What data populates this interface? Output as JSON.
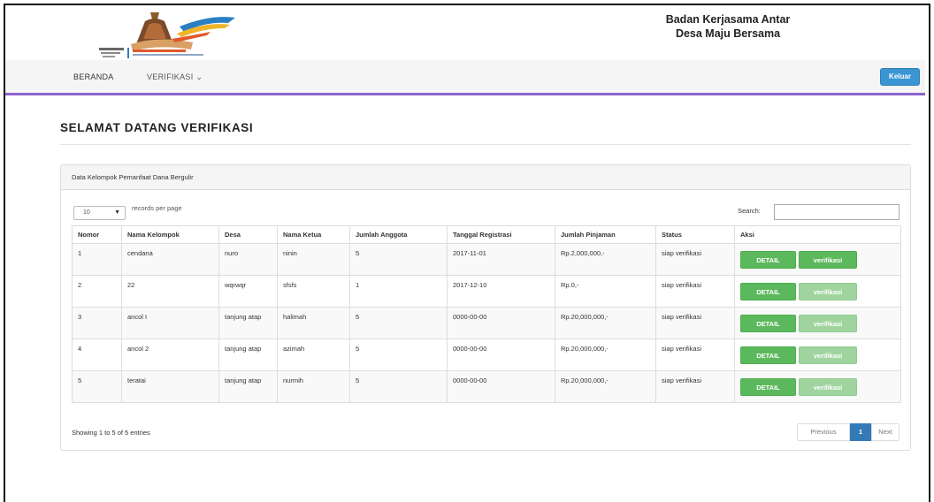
{
  "header": {
    "org_title": "Badan Kerjasama Antar Desa Maju Bersama"
  },
  "nav": {
    "items": [
      {
        "label": "BERANDA"
      },
      {
        "label": "VERIFIKASI ⌄"
      }
    ],
    "logout_label": "Keluar"
  },
  "page": {
    "title": "SELAMAT DATANG VERIFIKASI"
  },
  "panel": {
    "heading": "Data Kelompok Pemanfaat Dana Bergulir",
    "length_value": "10",
    "length_label": "records per page",
    "search_label": "Search:",
    "search_value": "",
    "columns": [
      "Nomor",
      "Nama Kelompok",
      "Desa",
      "Nama Ketua",
      "Jumlah Anggota",
      "Tanggal Registrasi",
      "Jumlah Pinjaman",
      "Status",
      "Aksi"
    ],
    "rows": [
      {
        "no": "1",
        "kelompok": "cendana",
        "desa": "nuro",
        "ketua": "ninin",
        "anggota": "5",
        "tanggal": "2017-11-01",
        "pinjaman": "Rp.2,000,000,-",
        "status": "siap verifikasi"
      },
      {
        "no": "2",
        "kelompok": "22",
        "desa": "wqrwqr",
        "ketua": "sfsfs",
        "anggota": "1",
        "tanggal": "2017-12-10",
        "pinjaman": "Rp.0,-",
        "status": "siap verifikasi"
      },
      {
        "no": "3",
        "kelompok": "ancol I",
        "desa": "tanjung atap",
        "ketua": "halimah",
        "anggota": "5",
        "tanggal": "0000-00-00",
        "pinjaman": "Rp.20,000,000,-",
        "status": "siap verifikasi"
      },
      {
        "no": "4",
        "kelompok": "ancol 2",
        "desa": "tanjung atap",
        "ketua": "azimah",
        "anggota": "5",
        "tanggal": "0000-00-00",
        "pinjaman": "Rp.20,000,000,-",
        "status": "siap verifikasi"
      },
      {
        "no": "5",
        "kelompok": "teratai",
        "desa": "tanjung atap",
        "ketua": "nurmih",
        "anggota": "5",
        "tanggal": "0000-00-00",
        "pinjaman": "Rp.20,000,000,-",
        "status": "siap verifikasi"
      }
    ],
    "detail_label": "DETAIL",
    "verify_label": "verifikasi",
    "info": "Showing 1 to 5 of 5 entries",
    "pager": {
      "prev": "Previous",
      "page": "1",
      "next": "Next"
    }
  },
  "colors": {
    "nav_accent": "#8e63cf",
    "logout": "#3b95d3",
    "success": "#5cb85c",
    "success_faded": "#9fd49f",
    "pager_active": "#337ab7"
  }
}
